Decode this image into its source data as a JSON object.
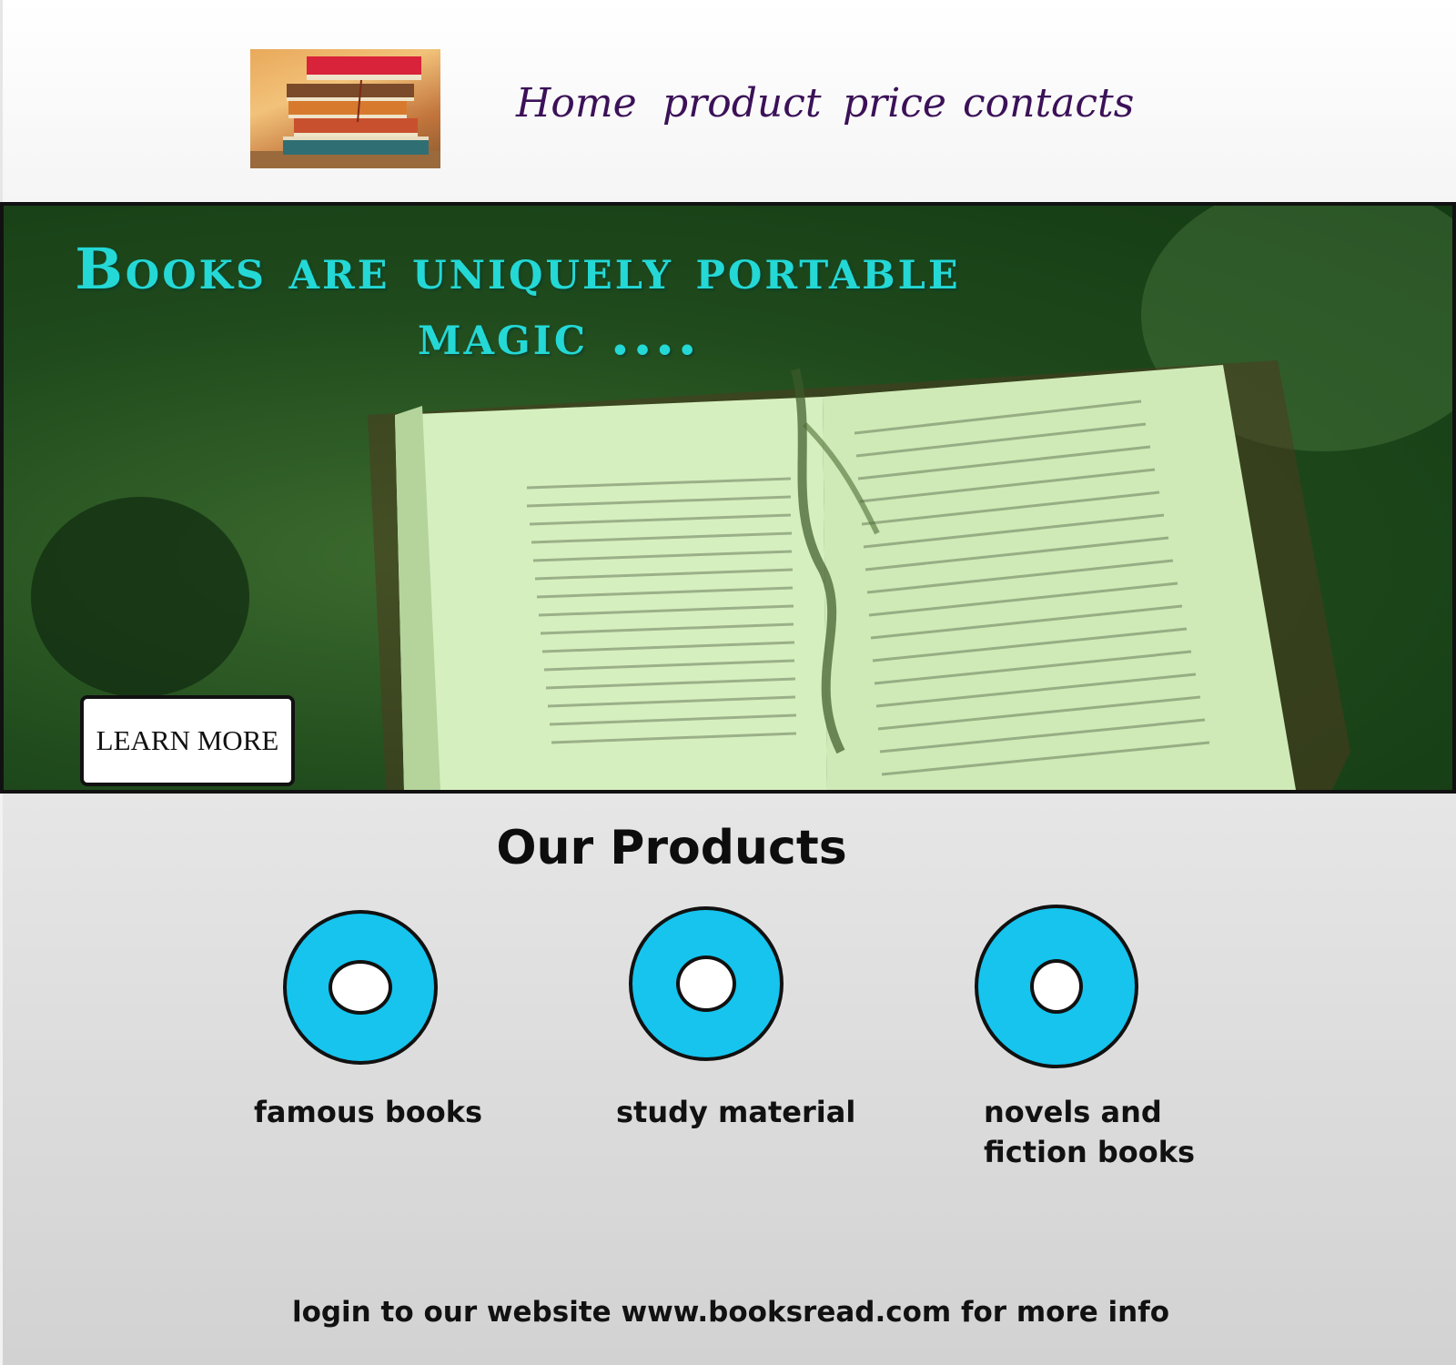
{
  "header": {
    "logo_icon": "book-stack-icon",
    "nav": [
      {
        "label": "Home"
      },
      {
        "label": "product"
      },
      {
        "label": "price"
      },
      {
        "label": "contacts"
      }
    ]
  },
  "hero": {
    "headline_line1": "Books are uniquely portable",
    "headline_line2": "magic ....",
    "button_label": "LEARN MORE",
    "accent_color": "#24d8d6"
  },
  "products": {
    "title": "Our Products",
    "items": [
      {
        "label_line1": "famous books",
        "label_line2": "",
        "icon": "ring-icon"
      },
      {
        "label_line1": "study material",
        "label_line2": "",
        "icon": "ring-icon"
      },
      {
        "label_line1": "novels and",
        "label_line2": "fiction books",
        "icon": "ring-icon"
      }
    ],
    "ring_color": "#16c4ee"
  },
  "footer": {
    "text": "login to our website www.booksread.com for more info"
  }
}
